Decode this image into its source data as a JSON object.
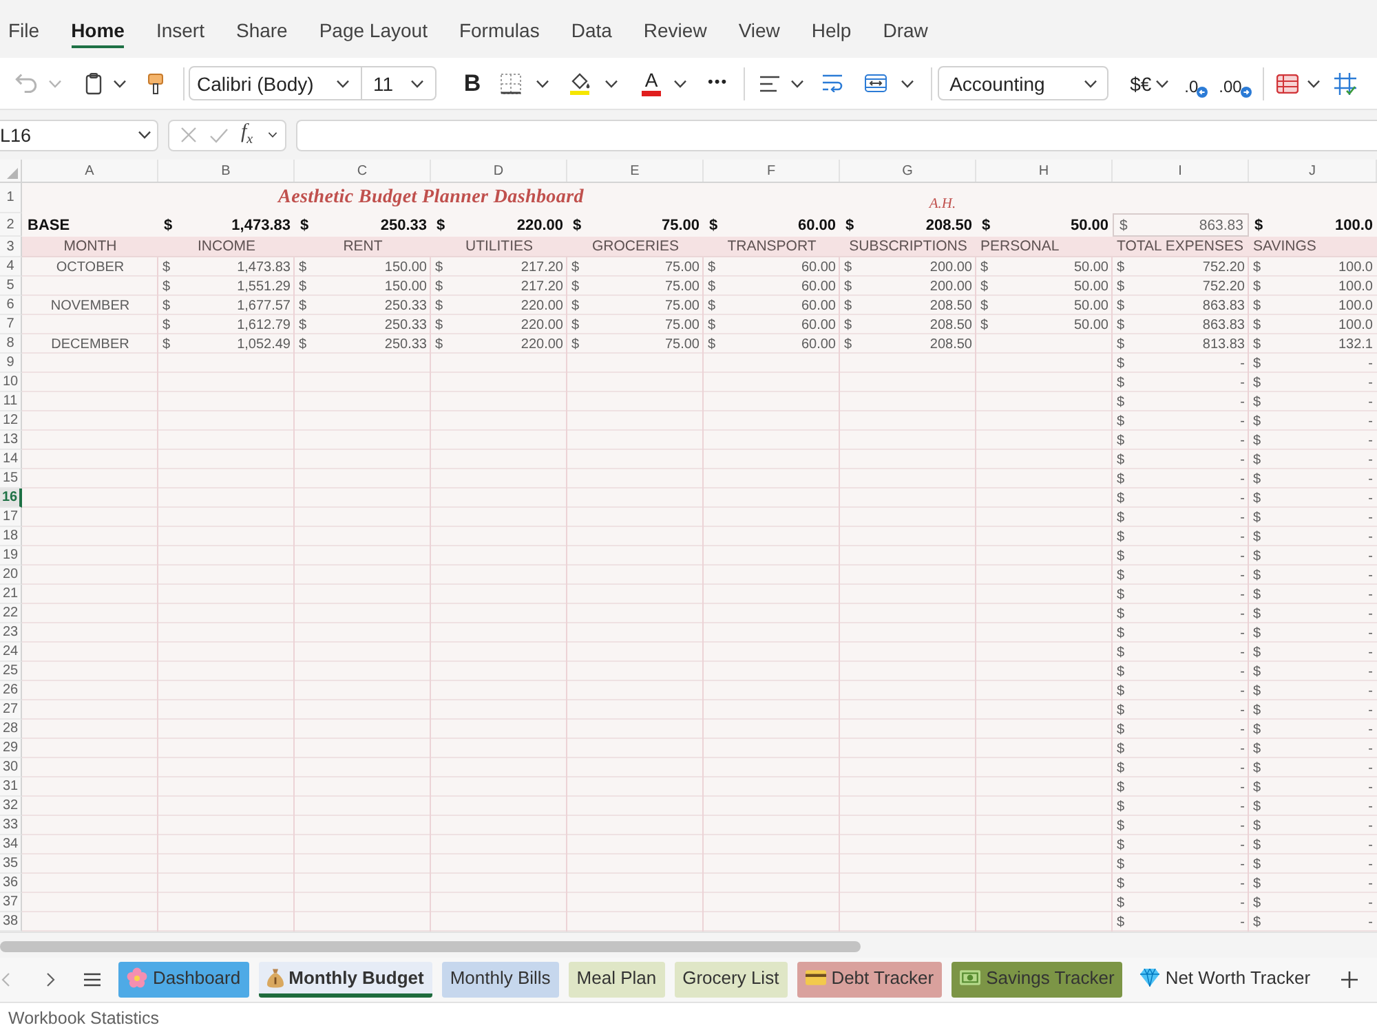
{
  "ribbon_tabs": [
    {
      "label": "File",
      "selected": false
    },
    {
      "label": "Home",
      "selected": true
    },
    {
      "label": "Insert",
      "selected": false
    },
    {
      "label": "Share",
      "selected": false
    },
    {
      "label": "Page Layout",
      "selected": false
    },
    {
      "label": "Formulas",
      "selected": false
    },
    {
      "label": "Data",
      "selected": false
    },
    {
      "label": "Review",
      "selected": false
    },
    {
      "label": "View",
      "selected": false
    },
    {
      "label": "Help",
      "selected": false
    },
    {
      "label": "Draw",
      "selected": false
    }
  ],
  "toolbar": {
    "undo_disabled": true,
    "font_name": "Calibri (Body)",
    "font_size": "11",
    "bold": "B",
    "font_color": "A",
    "more": "•••",
    "number_format": "Accounting",
    "currency": "$€",
    "decrease_decimal": ".0",
    "increase_decimal": ".00"
  },
  "formula_bar": {
    "name_box": "L16",
    "function": "f$_{x}$"
  },
  "sheet": {
    "columns": [
      "A",
      "B",
      "C",
      "D",
      "E",
      "F",
      "G",
      "H",
      "I",
      "J"
    ],
    "rows": [
      {
        "number": "1",
        "selected": false,
        "kind": "title",
        "title": "Aesthetic Budget Planner Dashboard",
        "note": "A.H."
      },
      {
        "number": "2",
        "selected": false,
        "kind": "base",
        "label": "BASE",
        "cells": [
          {
            "symbol": "$",
            "value": "1,473.83",
            "boxed": false
          },
          {
            "symbol": "$",
            "value": "250.33",
            "boxed": false
          },
          {
            "symbol": "$",
            "value": "220.00",
            "boxed": false
          },
          {
            "symbol": "$",
            "value": "75.00",
            "boxed": false
          },
          {
            "symbol": "$",
            "value": "60.00",
            "boxed": false
          },
          {
            "symbol": "$",
            "value": "208.50",
            "boxed": false
          },
          {
            "symbol": "$",
            "value": "50.00",
            "boxed": false
          },
          {
            "symbol": "$",
            "value": "863.83",
            "boxed": true
          },
          {
            "symbol": "$",
            "value": "100.0",
            "boxed": false
          }
        ]
      },
      {
        "number": "3",
        "selected": false,
        "kind": "header",
        "labels": [
          "MONTH",
          "INCOME",
          "RENT",
          "UTILITIES",
          "GROCERIES",
          "TRANSPORT",
          "SUBSCRIPTIONS",
          "PERSONAL",
          "TOTAL EXPENSES",
          "SAVINGS"
        ]
      },
      {
        "number": "4",
        "selected": false,
        "kind": "data",
        "label": "OCTOBER",
        "cells": [
          {
            "symbol": "$",
            "value": "1,473.83"
          },
          {
            "symbol": "$",
            "value": "150.00"
          },
          {
            "symbol": "$",
            "value": "217.20"
          },
          {
            "symbol": "$",
            "value": "75.00"
          },
          {
            "symbol": "$",
            "value": "60.00"
          },
          {
            "symbol": "$",
            "value": "200.00"
          },
          {
            "symbol": "$",
            "value": "50.00"
          },
          {
            "symbol": "$",
            "value": "752.20"
          },
          {
            "symbol": "$",
            "value": "100.0"
          }
        ]
      },
      {
        "number": "5",
        "selected": false,
        "kind": "data",
        "cells": [
          {
            "symbol": "$",
            "value": "1,551.29"
          },
          {
            "symbol": "$",
            "value": "150.00"
          },
          {
            "symbol": "$",
            "value": "217.20"
          },
          {
            "symbol": "$",
            "value": "75.00"
          },
          {
            "symbol": "$",
            "value": "60.00"
          },
          {
            "symbol": "$",
            "value": "200.00"
          },
          {
            "symbol": "$",
            "value": "50.00"
          },
          {
            "symbol": "$",
            "value": "752.20"
          },
          {
            "symbol": "$",
            "value": "100.0"
          }
        ]
      },
      {
        "number": "6",
        "selected": false,
        "kind": "data",
        "label": "NOVEMBER",
        "cells": [
          {
            "symbol": "$",
            "value": "1,677.57"
          },
          {
            "symbol": "$",
            "value": "250.33"
          },
          {
            "symbol": "$",
            "value": "220.00"
          },
          {
            "symbol": "$",
            "value": "75.00"
          },
          {
            "symbol": "$",
            "value": "60.00"
          },
          {
            "symbol": "$",
            "value": "208.50"
          },
          {
            "symbol": "$",
            "value": "50.00"
          },
          {
            "symbol": "$",
            "value": "863.83"
          },
          {
            "symbol": "$",
            "value": "100.0"
          }
        ]
      },
      {
        "number": "7",
        "selected": false,
        "kind": "data",
        "cells": [
          {
            "symbol": "$",
            "value": "1,612.79"
          },
          {
            "symbol": "$",
            "value": "250.33"
          },
          {
            "symbol": "$",
            "value": "220.00"
          },
          {
            "symbol": "$",
            "value": "75.00"
          },
          {
            "symbol": "$",
            "value": "60.00"
          },
          {
            "symbol": "$",
            "value": "208.50"
          },
          {
            "symbol": "$",
            "value": "50.00"
          },
          {
            "symbol": "$",
            "value": "863.83"
          },
          {
            "symbol": "$",
            "value": "100.0"
          }
        ]
      },
      {
        "number": "8",
        "selected": false,
        "kind": "data",
        "label": "DECEMBER",
        "cells": [
          {
            "symbol": "$",
            "value": "1,052.49"
          },
          {
            "symbol": "$",
            "value": "250.33"
          },
          {
            "symbol": "$",
            "value": "220.00"
          },
          {
            "symbol": "$",
            "value": "75.00"
          },
          {
            "symbol": "$",
            "value": "60.00"
          },
          {
            "symbol": "$",
            "value": "208.50"
          },
          null,
          {
            "symbol": "$",
            "value": "813.83"
          },
          {
            "symbol": "$",
            "value": "132.1"
          }
        ]
      },
      {
        "number": "9",
        "selected": false,
        "kind": "data",
        "cells": [
          null,
          null,
          null,
          null,
          null,
          null,
          null,
          {
            "symbol": "$",
            "value": "-"
          },
          {
            "symbol": "$",
            "value": "-"
          }
        ]
      },
      {
        "number": "10",
        "selected": false,
        "kind": "data",
        "cells": [
          null,
          null,
          null,
          null,
          null,
          null,
          null,
          {
            "symbol": "$",
            "value": "-"
          },
          {
            "symbol": "$",
            "value": "-"
          }
        ]
      },
      {
        "number": "11",
        "selected": false,
        "kind": "data",
        "cells": [
          null,
          null,
          null,
          null,
          null,
          null,
          null,
          {
            "symbol": "$",
            "value": "-"
          },
          {
            "symbol": "$",
            "value": "-"
          }
        ]
      },
      {
        "number": "12",
        "selected": false,
        "kind": "data",
        "cells": [
          null,
          null,
          null,
          null,
          null,
          null,
          null,
          {
            "symbol": "$",
            "value": "-"
          },
          {
            "symbol": "$",
            "value": "-"
          }
        ]
      },
      {
        "number": "13",
        "selected": false,
        "kind": "data",
        "cells": [
          null,
          null,
          null,
          null,
          null,
          null,
          null,
          {
            "symbol": "$",
            "value": "-"
          },
          {
            "symbol": "$",
            "value": "-"
          }
        ]
      },
      {
        "number": "14",
        "selected": false,
        "kind": "data",
        "cells": [
          null,
          null,
          null,
          null,
          null,
          null,
          null,
          {
            "symbol": "$",
            "value": "-"
          },
          {
            "symbol": "$",
            "value": "-"
          }
        ]
      },
      {
        "number": "15",
        "selected": false,
        "kind": "data",
        "cells": [
          null,
          null,
          null,
          null,
          null,
          null,
          null,
          {
            "symbol": "$",
            "value": "-"
          },
          {
            "symbol": "$",
            "value": "-"
          }
        ]
      },
      {
        "number": "16",
        "selected": true,
        "kind": "data",
        "cells": [
          null,
          null,
          null,
          null,
          null,
          null,
          null,
          {
            "symbol": "$",
            "value": "-"
          },
          {
            "symbol": "$",
            "value": "-"
          }
        ]
      },
      {
        "number": "17",
        "selected": false,
        "kind": "data",
        "cells": [
          null,
          null,
          null,
          null,
          null,
          null,
          null,
          {
            "symbol": "$",
            "value": "-"
          },
          {
            "symbol": "$",
            "value": "-"
          }
        ]
      },
      {
        "number": "18",
        "selected": false,
        "kind": "data",
        "cells": [
          null,
          null,
          null,
          null,
          null,
          null,
          null,
          {
            "symbol": "$",
            "value": "-"
          },
          {
            "symbol": "$",
            "value": "-"
          }
        ]
      },
      {
        "number": "19",
        "selected": false,
        "kind": "data",
        "cells": [
          null,
          null,
          null,
          null,
          null,
          null,
          null,
          {
            "symbol": "$",
            "value": "-"
          },
          {
            "symbol": "$",
            "value": "-"
          }
        ]
      },
      {
        "number": "20",
        "selected": false,
        "kind": "data",
        "cells": [
          null,
          null,
          null,
          null,
          null,
          null,
          null,
          {
            "symbol": "$",
            "value": "-"
          },
          {
            "symbol": "$",
            "value": "-"
          }
        ]
      },
      {
        "number": "21",
        "selected": false,
        "kind": "data",
        "cells": [
          null,
          null,
          null,
          null,
          null,
          null,
          null,
          {
            "symbol": "$",
            "value": "-"
          },
          {
            "symbol": "$",
            "value": "-"
          }
        ]
      },
      {
        "number": "22",
        "selected": false,
        "kind": "data",
        "cells": [
          null,
          null,
          null,
          null,
          null,
          null,
          null,
          {
            "symbol": "$",
            "value": "-"
          },
          {
            "symbol": "$",
            "value": "-"
          }
        ]
      },
      {
        "number": "23",
        "selected": false,
        "kind": "data",
        "cells": [
          null,
          null,
          null,
          null,
          null,
          null,
          null,
          {
            "symbol": "$",
            "value": "-"
          },
          {
            "symbol": "$",
            "value": "-"
          }
        ]
      },
      {
        "number": "24",
        "selected": false,
        "kind": "data",
        "cells": [
          null,
          null,
          null,
          null,
          null,
          null,
          null,
          {
            "symbol": "$",
            "value": "-"
          },
          {
            "symbol": "$",
            "value": "-"
          }
        ]
      },
      {
        "number": "25",
        "selected": false,
        "kind": "data",
        "cells": [
          null,
          null,
          null,
          null,
          null,
          null,
          null,
          {
            "symbol": "$",
            "value": "-"
          },
          {
            "symbol": "$",
            "value": "-"
          }
        ]
      },
      {
        "number": "26",
        "selected": false,
        "kind": "data",
        "cells": [
          null,
          null,
          null,
          null,
          null,
          null,
          null,
          {
            "symbol": "$",
            "value": "-"
          },
          {
            "symbol": "$",
            "value": "-"
          }
        ]
      },
      {
        "number": "27",
        "selected": false,
        "kind": "data",
        "cells": [
          null,
          null,
          null,
          null,
          null,
          null,
          null,
          {
            "symbol": "$",
            "value": "-"
          },
          {
            "symbol": "$",
            "value": "-"
          }
        ]
      },
      {
        "number": "28",
        "selected": false,
        "kind": "data",
        "cells": [
          null,
          null,
          null,
          null,
          null,
          null,
          null,
          {
            "symbol": "$",
            "value": "-"
          },
          {
            "symbol": "$",
            "value": "-"
          }
        ]
      },
      {
        "number": "29",
        "selected": false,
        "kind": "data",
        "cells": [
          null,
          null,
          null,
          null,
          null,
          null,
          null,
          {
            "symbol": "$",
            "value": "-"
          },
          {
            "symbol": "$",
            "value": "-"
          }
        ]
      },
      {
        "number": "30",
        "selected": false,
        "kind": "data",
        "cells": [
          null,
          null,
          null,
          null,
          null,
          null,
          null,
          {
            "symbol": "$",
            "value": "-"
          },
          {
            "symbol": "$",
            "value": "-"
          }
        ]
      },
      {
        "number": "31",
        "selected": false,
        "kind": "data",
        "cells": [
          null,
          null,
          null,
          null,
          null,
          null,
          null,
          {
            "symbol": "$",
            "value": "-"
          },
          {
            "symbol": "$",
            "value": "-"
          }
        ]
      },
      {
        "number": "32",
        "selected": false,
        "kind": "data",
        "cells": [
          null,
          null,
          null,
          null,
          null,
          null,
          null,
          {
            "symbol": "$",
            "value": "-"
          },
          {
            "symbol": "$",
            "value": "-"
          }
        ]
      },
      {
        "number": "33",
        "selected": false,
        "kind": "data",
        "cells": [
          null,
          null,
          null,
          null,
          null,
          null,
          null,
          {
            "symbol": "$",
            "value": "-"
          },
          {
            "symbol": "$",
            "value": "-"
          }
        ]
      },
      {
        "number": "34",
        "selected": false,
        "kind": "data",
        "cells": [
          null,
          null,
          null,
          null,
          null,
          null,
          null,
          {
            "symbol": "$",
            "value": "-"
          },
          {
            "symbol": "$",
            "value": "-"
          }
        ]
      },
      {
        "number": "35",
        "selected": false,
        "kind": "data",
        "cells": [
          null,
          null,
          null,
          null,
          null,
          null,
          null,
          {
            "symbol": "$",
            "value": "-"
          },
          {
            "symbol": "$",
            "value": "-"
          }
        ]
      },
      {
        "number": "36",
        "selected": false,
        "kind": "data",
        "cells": [
          null,
          null,
          null,
          null,
          null,
          null,
          null,
          {
            "symbol": "$",
            "value": "-"
          },
          {
            "symbol": "$",
            "value": "-"
          }
        ]
      },
      {
        "number": "37",
        "selected": false,
        "kind": "data",
        "cells": [
          null,
          null,
          null,
          null,
          null,
          null,
          null,
          {
            "symbol": "$",
            "value": "-"
          },
          {
            "symbol": "$",
            "value": "-"
          }
        ]
      },
      {
        "number": "38",
        "selected": false,
        "kind": "data",
        "cells": [
          null,
          null,
          null,
          null,
          null,
          null,
          null,
          {
            "symbol": "$",
            "value": "-"
          },
          {
            "symbol": "$",
            "value": "-"
          }
        ]
      }
    ]
  },
  "sheet_nav": {
    "previous_disabled": true
  },
  "sheet_tabs": [
    {
      "label": "Dashboard",
      "color": "#4eaae6",
      "selected": false
    },
    {
      "label": "Monthly Budget",
      "color": "#e6ecf6",
      "selected": true
    },
    {
      "label": "Monthly Bills",
      "color": "#c6d7ed",
      "selected": false
    },
    {
      "label": "Meal Plan",
      "color": "#dfe6c6",
      "selected": false
    },
    {
      "label": "Grocery List",
      "color": "#dfe6c6",
      "selected": false
    },
    {
      "label": "Debt Tracker",
      "color": "#d9a19d",
      "selected": false
    },
    {
      "label": "Savings Tracker",
      "color": "#7c9546",
      "selected": false
    },
    {
      "label": "Net Worth Tracker",
      "selected": false
    }
  ],
  "status_bar": {
    "text": "Workbook Statistics"
  }
}
